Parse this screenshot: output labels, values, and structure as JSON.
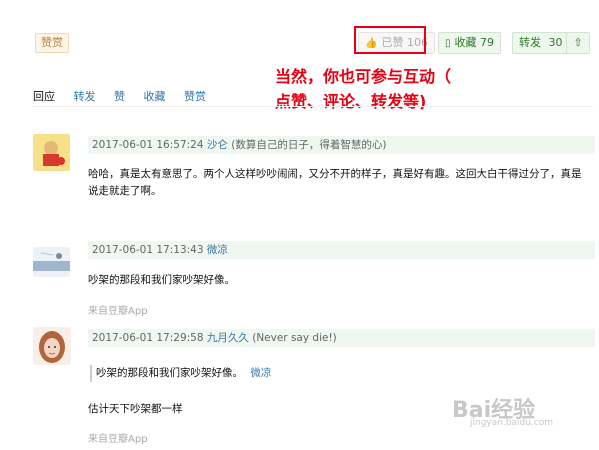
{
  "actions": {
    "zan_label": "赞赏",
    "liked_label": "已赞 106",
    "collect_label": "收藏 79",
    "forward_label": "转发",
    "forward_count": "30"
  },
  "annotation": {
    "line1": "当然，你也可参与互动（",
    "line2": "点赞、评论、转发等)"
  },
  "tabs": [
    "回应",
    "转发",
    "赞",
    "收藏",
    "赞赏"
  ],
  "comments": [
    {
      "time": "2017-06-01 16:57:24",
      "user": "沙仑",
      "signature": "(数算自己的日子，得着智慧的心)",
      "text": "哈哈，真是太有意思了。两个人这样吵吵闹闹，又分不开的样子，真是好有趣。这回大白干得过分了，真是说走就走了啊。"
    },
    {
      "time": "2017-06-01 17:13:43",
      "user": "微凉",
      "text": "吵架的那段和我们家吵架好像。",
      "source": "来自豆瓣App"
    },
    {
      "time": "2017-06-01 17:29:58",
      "user": "九月久久",
      "signature": "(Never say die!)",
      "quote_text": "吵架的那段和我们家吵架好像。",
      "quote_author": "微凉",
      "text": "估计天下吵架都一样",
      "source": "来自豆瓣App"
    }
  ],
  "watermark": {
    "brand": "Bai经验",
    "url": "jingyan.baidu.com"
  }
}
